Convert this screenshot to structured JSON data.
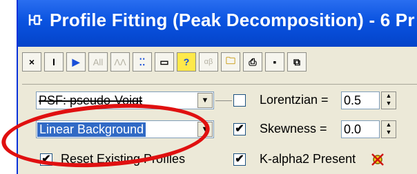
{
  "window": {
    "title": "Profile Fitting (Peak Decomposition) - 6 Pr",
    "colors": {
      "titlebar": "#0a53e0",
      "face": "#ece9d8",
      "highlight_ring": "#e01010",
      "selection": "#316ac5"
    }
  },
  "toolbar": {
    "buttons": [
      {
        "name": "close",
        "label": "×"
      },
      {
        "name": "text-cursor",
        "label": "I"
      },
      {
        "name": "play",
        "label": "▶"
      },
      {
        "name": "all",
        "label": "All"
      },
      {
        "name": "peaks",
        "label": "ΛΛ"
      },
      {
        "name": "expand",
        "label": "⁚⁚"
      },
      {
        "name": "panel",
        "label": "▭"
      },
      {
        "name": "help",
        "label": "?"
      },
      {
        "name": "alpha-beta",
        "label": "αβ"
      },
      {
        "name": "open-folder",
        "label": "🗀"
      },
      {
        "name": "print",
        "label": "⎙"
      },
      {
        "name": "save",
        "label": "▪"
      },
      {
        "name": "copy",
        "label": "⧉"
      }
    ]
  },
  "controls": {
    "psf_value": "PSF: pseudo-Voigt",
    "background_value": "Linear Background",
    "reset_label": "Reset Existing Profiles",
    "reset_checked": "✔",
    "lorentzian_label": "Lorentzian =",
    "lorentzian_value": "0.5",
    "lorentzian_checked": "",
    "skewness_label": "Skewness =",
    "skewness_value": "0.0",
    "skewness_checked": "✔",
    "kalpha_label": "K-alpha2 Present",
    "kalpha_checked": "✔"
  }
}
